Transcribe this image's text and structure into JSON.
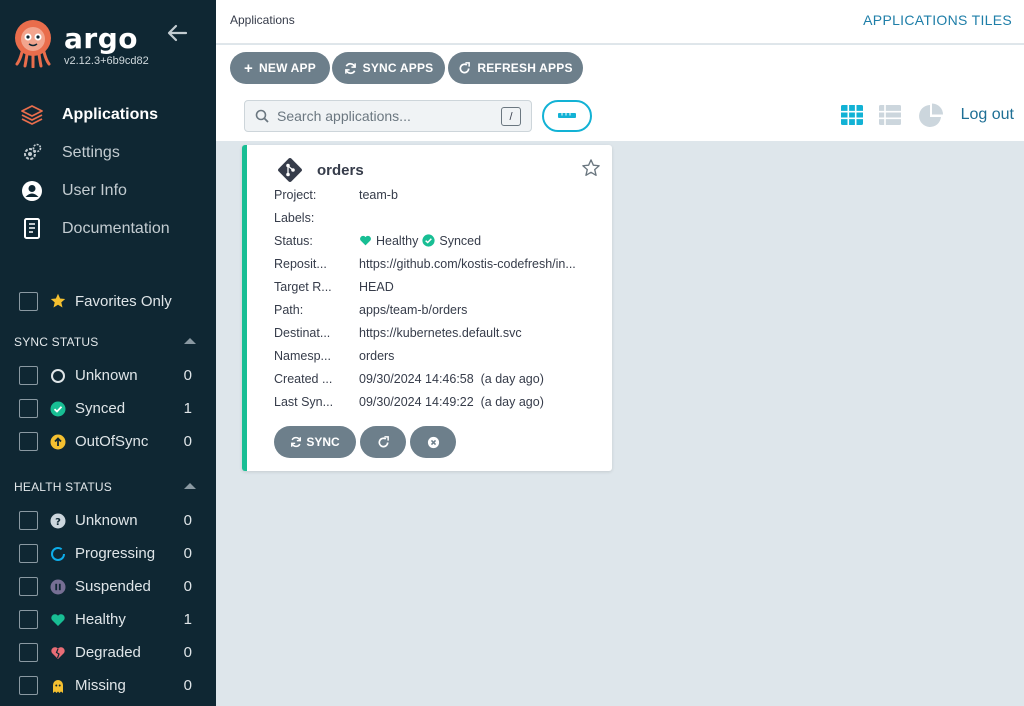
{
  "sidebar": {
    "brand": "argo",
    "version": "v2.12.3+6b9cd82",
    "nav": [
      {
        "label": "Applications",
        "icon": "layers-icon"
      },
      {
        "label": "Settings",
        "icon": "gears-icon"
      },
      {
        "label": "User Info",
        "icon": "user-circle-icon"
      },
      {
        "label": "Documentation",
        "icon": "book-icon"
      }
    ],
    "favorites_label": "Favorites Only",
    "sync_status": {
      "title": "SYNC STATUS",
      "items": [
        {
          "label": "Unknown",
          "count": "0",
          "icon": "circle-outline-icon",
          "color": "#dfe5e8"
        },
        {
          "label": "Synced",
          "count": "1",
          "icon": "check-circle-icon",
          "color": "#18be94"
        },
        {
          "label": "OutOfSync",
          "count": "0",
          "icon": "arrow-up-circle-icon",
          "color": "#f4c030"
        }
      ]
    },
    "health_status": {
      "title": "HEALTH STATUS",
      "items": [
        {
          "label": "Unknown",
          "count": "0",
          "icon": "question-circle-icon",
          "color": "#ccd6dd"
        },
        {
          "label": "Progressing",
          "count": "0",
          "icon": "progress-circle-icon",
          "color": "#0dadea"
        },
        {
          "label": "Suspended",
          "count": "0",
          "icon": "pause-circle-icon",
          "color": "#766f94"
        },
        {
          "label": "Healthy",
          "count": "1",
          "icon": "heart-icon",
          "color": "#18be94"
        },
        {
          "label": "Degraded",
          "count": "0",
          "icon": "broken-heart-icon",
          "color": "#e96d76"
        },
        {
          "label": "Missing",
          "count": "0",
          "icon": "ghost-icon",
          "color": "#f4c030"
        }
      ]
    }
  },
  "header": {
    "breadcrumb": "Applications",
    "title": "APPLICATIONS TILES"
  },
  "toolbar": {
    "new_app": "NEW APP",
    "sync_apps": "SYNC APPS",
    "refresh_apps": "REFRESH APPS",
    "search_placeholder": "Search applications...",
    "search_shortcut": "/",
    "logout": "Log out"
  },
  "app": {
    "name": "orders",
    "rows": [
      {
        "key": "Project:",
        "value": "team-b"
      },
      {
        "key": "Labels:",
        "value": ""
      },
      {
        "key": "Status:",
        "value": ""
      },
      {
        "key": "Reposit...",
        "value": "https://github.com/kostis-codefresh/in..."
      },
      {
        "key": "Target R...",
        "value": "HEAD"
      },
      {
        "key": "Path:",
        "value": "apps/team-b/orders"
      },
      {
        "key": "Destinat...",
        "value": "https://kubernetes.default.svc"
      },
      {
        "key": "Namesp...",
        "value": "orders"
      },
      {
        "key": "Created ...",
        "value": "09/30/2024 14:46:58  (a day ago)"
      },
      {
        "key": "Last Syn...",
        "value": "09/30/2024 14:49:22  (a day ago)"
      }
    ],
    "health": "Healthy",
    "sync": "Synced",
    "sync_button": "SYNC"
  },
  "colors": {
    "sidebar_bg": "#0f2733",
    "accent": "#1e7ea8",
    "healthy": "#18be94",
    "button": "#6d7f8b"
  }
}
